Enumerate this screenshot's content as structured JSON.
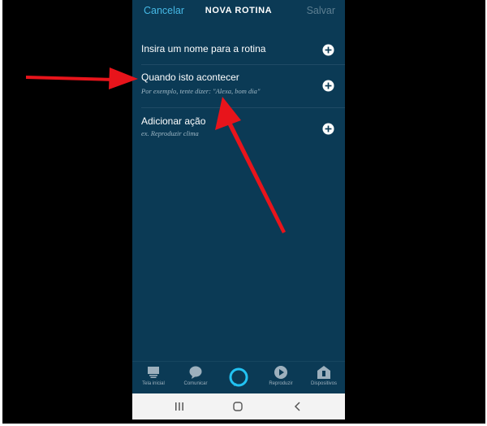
{
  "header": {
    "cancel_label": "Cancelar",
    "title": "NOVA ROTINA",
    "save_label": "Salvar"
  },
  "rows": [
    {
      "title": "Insira um nome para a rotina",
      "subtitle": ""
    },
    {
      "title": "Quando isto acontecer",
      "subtitle": "Por exemplo, tente dizer: \"Alexa, bom dia\""
    },
    {
      "title": "Adicionar ação",
      "subtitle": "ex. Reproduzir clima"
    }
  ],
  "nav": [
    {
      "label": "Tela inicial",
      "icon": "home-icon"
    },
    {
      "label": "Comunicar",
      "icon": "chat-bubble-icon"
    },
    {
      "label": "",
      "icon": "alexa-ring-icon"
    },
    {
      "label": "Reproduzir",
      "icon": "play-icon"
    },
    {
      "label": "Dispositivos",
      "icon": "devices-icon"
    }
  ],
  "system_nav": [
    "recent-apps-icon",
    "home-button-icon",
    "back-icon"
  ],
  "colors": {
    "background": "#0b3a55",
    "accent": "#46b9e6",
    "disabled": "#5d7f92",
    "annotation_arrow": "#e8141b"
  }
}
